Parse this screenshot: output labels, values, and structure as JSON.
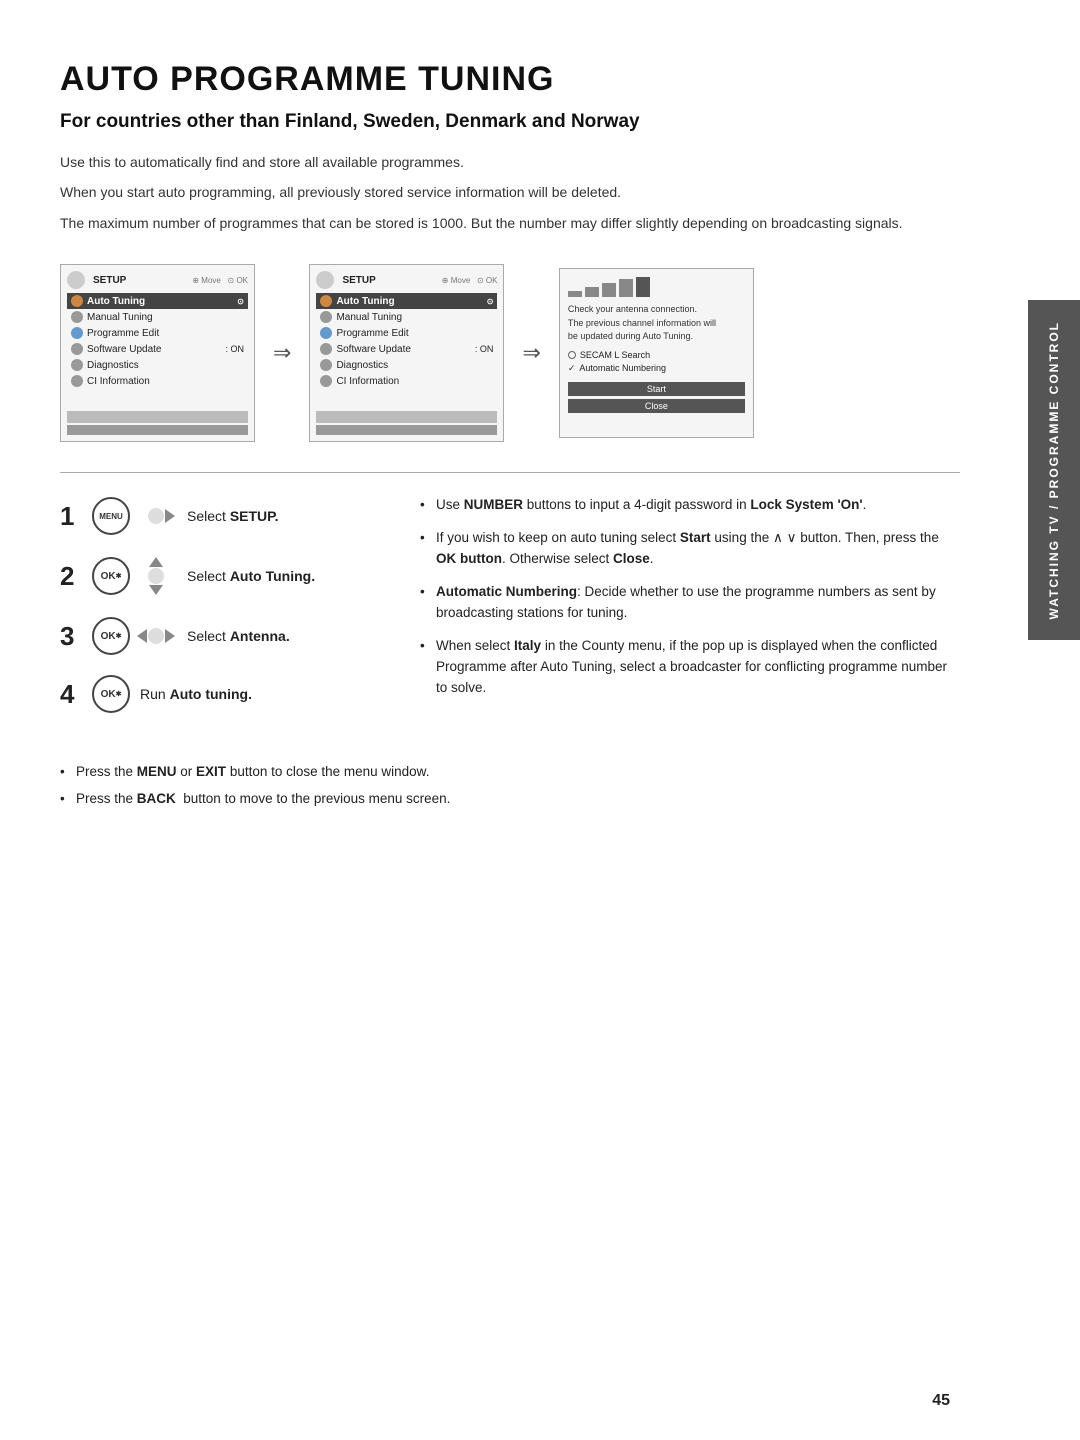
{
  "page": {
    "title": "AUTO PROGRAMME TUNING",
    "subtitle": "For countries other than Finland, Sweden, Denmark and Norway",
    "intro_lines": [
      "Use this to automatically find and store all available programmes.",
      "When you start auto programming, all previously stored service information will be deleted.",
      "The maximum number of programmes that can be stored is 1000. But the number may differ slightly depending on broadcasting signals."
    ]
  },
  "screens": {
    "screen1": {
      "header": "SETUP",
      "controls": "Move  OK",
      "items": [
        {
          "label": "Auto Tuning",
          "active": true,
          "icon": "orange"
        },
        {
          "label": "Manual Tuning",
          "active": false,
          "icon": "gray"
        },
        {
          "label": "Programme Edit",
          "active": false,
          "icon": "blue"
        },
        {
          "label": "Software Update",
          "active": false,
          "icon": "gray",
          "value": ": ON"
        },
        {
          "label": "Diagnostics",
          "active": false,
          "icon": "gray"
        },
        {
          "label": "CI Information",
          "active": false,
          "icon": "gray"
        }
      ]
    },
    "screen2": {
      "header": "SETUP",
      "controls": "Move  OK",
      "items": [
        {
          "label": "Auto Tuning",
          "active": true,
          "icon": "orange"
        },
        {
          "label": "Manual Tuning",
          "active": false,
          "icon": "gray"
        },
        {
          "label": "Programme Edit",
          "active": false,
          "icon": "blue"
        },
        {
          "label": "Software Update",
          "active": false,
          "icon": "gray",
          "value": ": ON"
        },
        {
          "label": "Diagnostics",
          "active": false,
          "icon": "gray"
        },
        {
          "label": "CI Information",
          "active": false,
          "icon": "gray"
        }
      ]
    },
    "screen3": {
      "antenna_text": "Check your antenna connection.\nThe previous channel information will\nbe updated during Auto Tuning.",
      "options": [
        {
          "label": "SECAM L Search",
          "type": "radio",
          "checked": false
        },
        {
          "label": "Automatic Numbering",
          "type": "check",
          "checked": true
        }
      ],
      "buttons": [
        "Start",
        "Close"
      ]
    }
  },
  "steps": [
    {
      "number": "1",
      "buttons": [
        "MENU",
        "dpad-right"
      ],
      "label": "Select <strong>SETUP.</strong>"
    },
    {
      "number": "2",
      "buttons": [
        "OK",
        "dpad-updown"
      ],
      "label": "Select <strong>Auto Tuning.</strong>"
    },
    {
      "number": "3",
      "buttons": [
        "OK",
        "dpad-leftright"
      ],
      "label": "Select <strong>Antenna.</strong>"
    },
    {
      "number": "4",
      "buttons": [
        "OK"
      ],
      "label": "Run <strong>Auto tuning.</strong>"
    }
  ],
  "info_bullets": [
    "Use <strong>NUMBER</strong> buttons to input a 4-digit password in <strong>Lock System 'On'</strong>.",
    "If you wish to keep on auto tuning select <strong>Start</strong> using the ∧ ∨ button. Then, press the <strong>OK button</strong>. Otherwise select <strong>Close</strong>.",
    "<strong>Automatic Numbering</strong>: Decide whether to use the programme numbers as sent by broadcasting stations for tuning.",
    "When select <strong>Italy</strong> in the County menu, if the pop up is displayed when the conflicted Programme after Auto Tuning, select a broadcaster for conflicting programme number to solve."
  ],
  "footer_notes": [
    "Press the <strong>MENU</strong> or <strong>EXIT</strong> button to close the menu window.",
    "Press the <strong>BACK</strong>  button to move to the previous menu screen."
  ],
  "side_tab": "WATCHING TV / PROGRAMME CONTROL",
  "page_number": "45"
}
